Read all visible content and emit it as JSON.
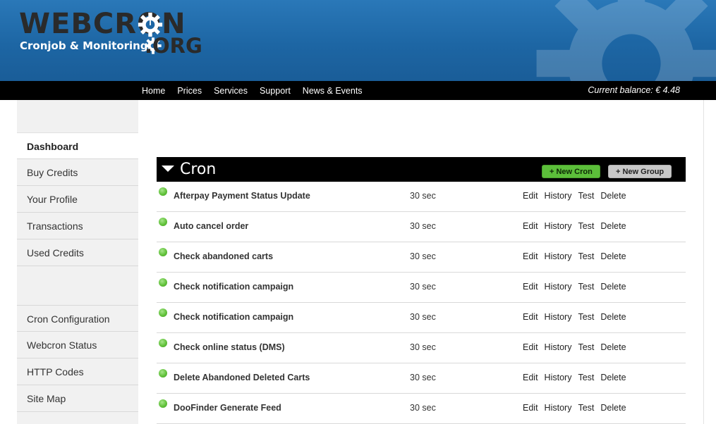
{
  "logo": {
    "main": "WEBCRON",
    "tld": ".ORG",
    "tagline": "Cronjob & Monitoring"
  },
  "nav": [
    "Home",
    "Prices",
    "Services",
    "Support",
    "News & Events"
  ],
  "balance": "Current balance: € 4.48",
  "sidebar": {
    "top": [
      "Dashboard",
      "Buy Credits",
      "Your Profile",
      "Transactions",
      "Used Credits"
    ],
    "bottom": [
      "Cron Configuration",
      "Webcron Status",
      "HTTP Codes",
      "Site Map"
    ]
  },
  "cron": {
    "title": "Cron",
    "new_cron": "+ New Cron",
    "new_group": "+ New Group",
    "actions": [
      "Edit",
      "History",
      "Test",
      "Delete"
    ],
    "rows": [
      {
        "name": "Afterpay Payment Status Update",
        "interval": "30 sec"
      },
      {
        "name": "Auto cancel order",
        "interval": "30 sec"
      },
      {
        "name": "Check abandoned carts",
        "interval": "30 sec"
      },
      {
        "name": "Check notification campaign",
        "interval": "30 sec"
      },
      {
        "name": "Check notification campaign",
        "interval": "30 sec"
      },
      {
        "name": "Check online status (DMS)",
        "interval": "30 sec"
      },
      {
        "name": "Delete Abandoned Deleted Carts",
        "interval": "30 sec"
      },
      {
        "name": "DooFinder Generate Feed",
        "interval": "30 sec"
      }
    ]
  },
  "colors": {
    "header_blue": "#1d66a4",
    "status_green": "#62c23b",
    "nav_black": "#000000"
  }
}
